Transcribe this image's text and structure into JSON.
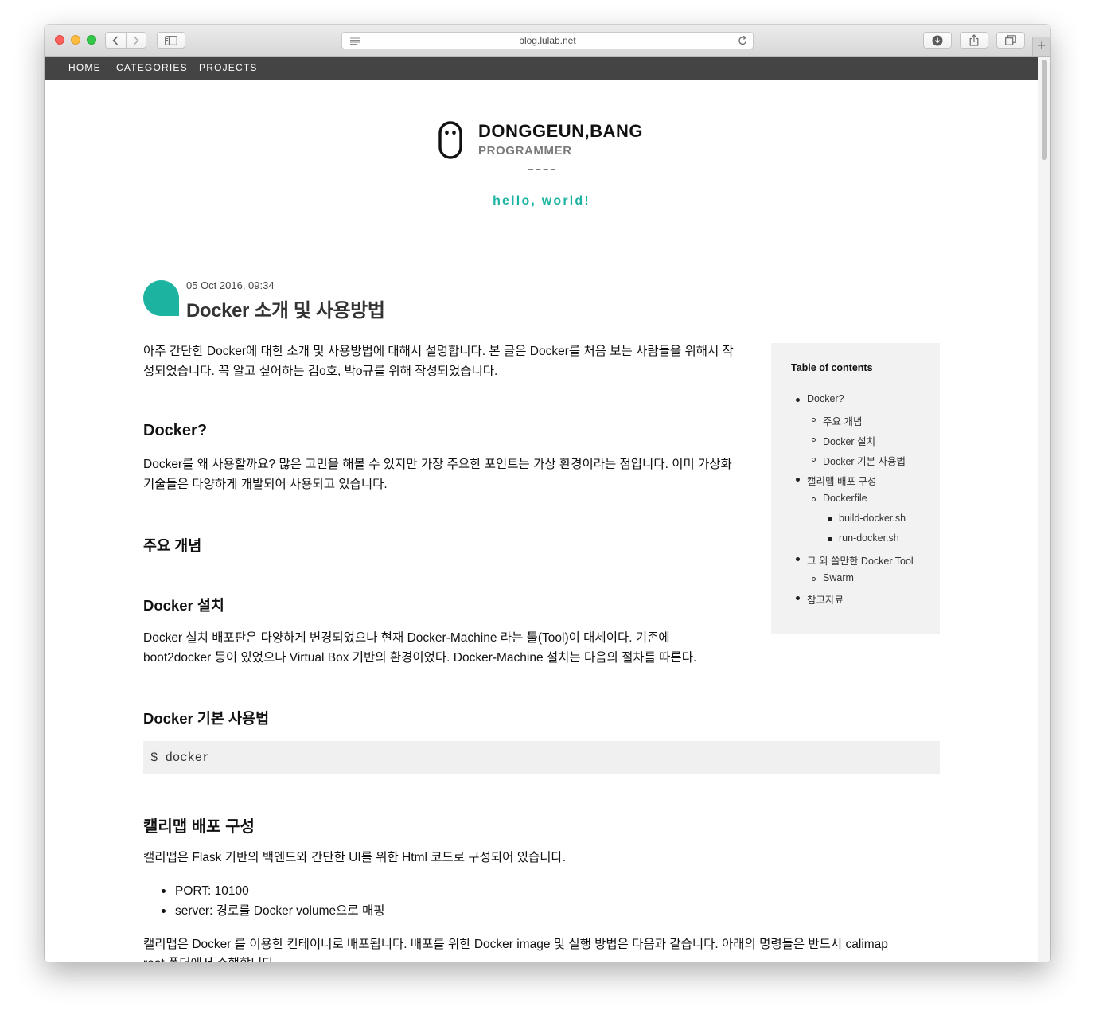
{
  "browser": {
    "url": "blog.lulab.net"
  },
  "nav": {
    "items": [
      "HOME",
      "CATEGORIES",
      "PROJECTS"
    ]
  },
  "header": {
    "name": "DONGGEUN,BANG",
    "role": "PROGRAMMER",
    "divider": "___",
    "motto": "hello, world!"
  },
  "post": {
    "date": "05 Oct 2016, 09:34",
    "title": "Docker 소개 및 사용방법",
    "intro_line1": "아주 간단한 Docker에 대한 소개 및 사용방법에 대해서 설명합니다. 본 글은 Docker를 처음 보는 사람들을 위해서 작",
    "intro_line2": "성되었습니다. 꼭 알고 싶어하는 김o호, 박o규를 위해 작성되었습니다.",
    "sections": {
      "docker_heading": "Docker?",
      "docker_p1": "Docker를 왜 사용할까요? 많은 고민을 해볼 수 있지만 가장 주요한 포인트는 가상  환경이라는 점입니다. 이미 가상화",
      "docker_p2": "기술들은 다양하게 개발되어 사용되고 있습니다.",
      "concept_heading": "주요 개념",
      "install_heading": "Docker 설치",
      "install_p1": "Docker 설치 배포판은 다양하게 변경되었으나 현재 Docker-Machine 라는 툴(Tool)이 대세이다. 기존에",
      "install_p2": "boot2docker 등이 있었으나 Virtual Box 기반의 환경이었다. Docker-Machine 설치는 다음의 절차를 따른다.",
      "usage_heading": "Docker 기본 사용법",
      "code": "$ docker",
      "calimap_heading": "캘리맵 배포 구성",
      "calimap_p": "캘리맵은 Flask 기반의 백엔드와 간단한 UI를 위한 Html 코드로 구성되어 있습니다.",
      "bullets": [
        "PORT: 10100",
        "server: 경로를 Docker volume으로 매핑"
      ],
      "calimap_p2": "캘리맵은 Docker 를 이용한 컨테이너로 배포됩니다. 배포를 위한 Docker image 및 실행 방법은 다음과 같습니다. 아래의 명령들은 반드시 calimap",
      "calimap_p3": "root 폴더에서 수행합니다."
    }
  },
  "toc": {
    "title": "Table of contents",
    "items": [
      {
        "level": 1,
        "label": "Docker?"
      },
      {
        "level": 2,
        "label": "주요 개념"
      },
      {
        "level": 2,
        "label": "Docker 설치"
      },
      {
        "level": 2,
        "label": "Docker 기본 사용법"
      },
      {
        "level": 1,
        "label": "캘리맵 배포 구성"
      },
      {
        "level": 2,
        "label": "Dockerfile"
      },
      {
        "level": 3,
        "label": "build-docker.sh"
      },
      {
        "level": 3,
        "label": "run-docker.sh"
      },
      {
        "level": 1,
        "label": "그 외 쓸만한 Docker Tool"
      },
      {
        "level": 2,
        "label": "Swarm"
      },
      {
        "level": 1,
        "label": "참고자료"
      }
    ]
  },
  "colors": {
    "accent": "#1cb3a0",
    "nav_bg": "#444444",
    "toc_bg": "#f2f2f2",
    "code_bg": "#f0f0f0"
  },
  "icons": {
    "logo": "ghost-logo-icon",
    "toolbar": [
      "back-icon",
      "forward-icon",
      "sidebar-icon",
      "reader-icon",
      "reload-icon",
      "download-icon",
      "share-icon",
      "tabs-icon",
      "new-tab-icon"
    ]
  }
}
